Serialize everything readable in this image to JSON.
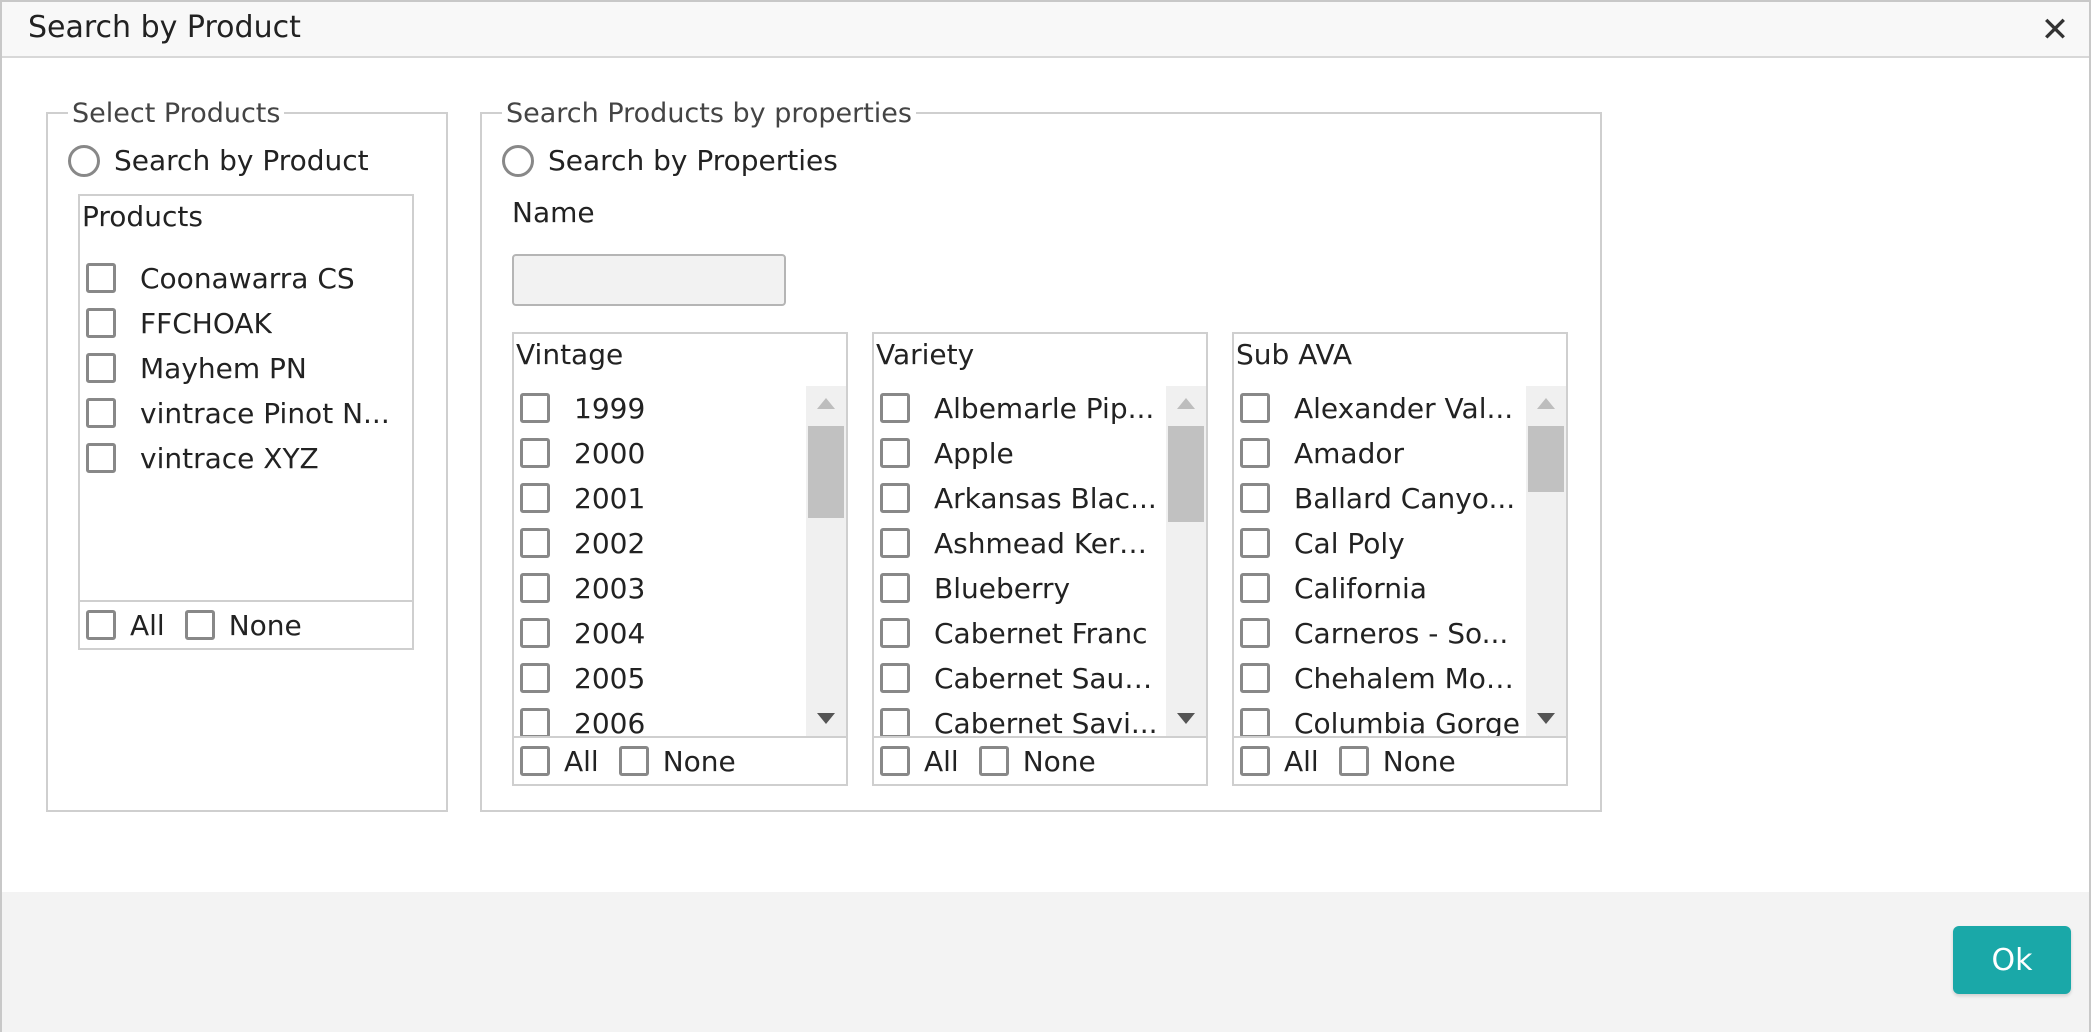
{
  "dialog": {
    "title": "Search by Product",
    "ok_label": "Ok"
  },
  "select_products": {
    "legend": "Select Products",
    "radio_label": "Search by Product",
    "products": {
      "title": "Products",
      "items": [
        "Coonawarra CS",
        "FFCHOAK",
        "Mayhem PN",
        "vintrace Pinot N...",
        "vintrace XYZ"
      ],
      "all_label": "All",
      "none_label": "None"
    }
  },
  "search_properties": {
    "legend": "Search Products by properties",
    "radio_label": "Search by Properties",
    "name_label": "Name",
    "name_value": "",
    "vintage": {
      "title": "Vintage",
      "items": [
        "1999",
        "2000",
        "2001",
        "2002",
        "2003",
        "2004",
        "2005",
        "2006"
      ],
      "all_label": "All",
      "none_label": "None"
    },
    "variety": {
      "title": "Variety",
      "items": [
        "Albemarle Pip...",
        "Apple",
        "Arkansas Blac...",
        "Ashmead Kerne...",
        "Blueberry",
        "Cabernet Franc",
        "Cabernet Sauv...",
        "Cabernet Savi..."
      ],
      "all_label": "All",
      "none_label": "None"
    },
    "sub_ava": {
      "title": "Sub AVA",
      "items": [
        "Alexander Val...",
        "Amador",
        "Ballard Canyo...",
        "Cal Poly",
        "California",
        "Carneros - So...",
        "Chehalem Moun...",
        "Columbia Gorge"
      ],
      "all_label": "All",
      "none_label": "None"
    }
  }
}
